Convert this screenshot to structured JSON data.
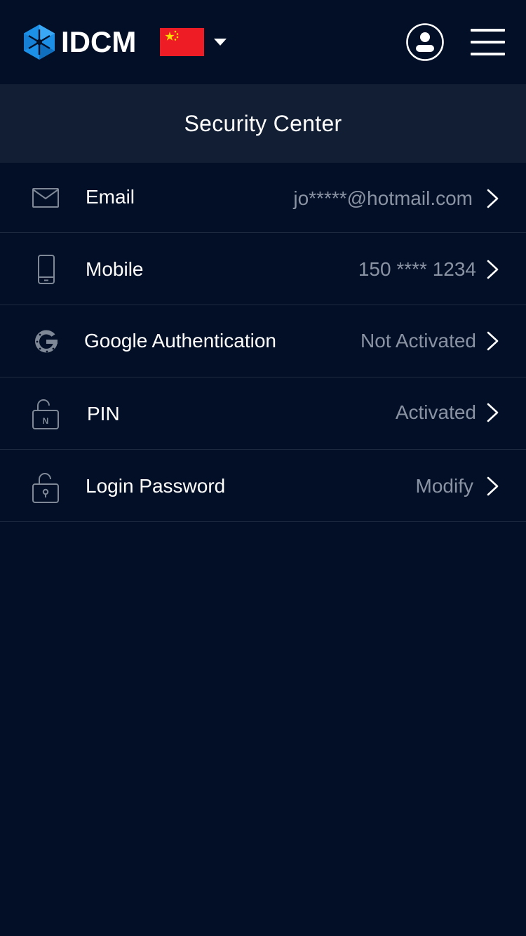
{
  "header": {
    "brand": "IDCM",
    "language_flag": "china-flag",
    "icons": {
      "logo": "idcm-logo-icon",
      "dropdown": "caret-down-icon",
      "profile": "user-circle-icon",
      "menu": "hamburger-menu-icon"
    }
  },
  "title_bar": {
    "title": "Security Center"
  },
  "security_items": [
    {
      "icon": "envelope-icon",
      "label": "Email",
      "value": "jo*****@hotmail.com"
    },
    {
      "icon": "phone-icon",
      "label": "Mobile",
      "value": "150 **** 1234"
    },
    {
      "icon": "google-icon",
      "label": "Google Authentication",
      "value": "Not Activated"
    },
    {
      "icon": "pin-lock-icon",
      "label": "PIN",
      "value": "Activated"
    },
    {
      "icon": "padlock-icon",
      "label": "Login Password",
      "value": "Modify"
    }
  ],
  "colors": {
    "background": "#020f26",
    "title_bar": "#121e33",
    "divider": "#1d2a40",
    "value_text": "#8a93a3",
    "icon_stroke": "#7f8896",
    "brand_blue": "#1c8fe6",
    "flag_red": "#ee1c25",
    "flag_yellow": "#ffde00"
  }
}
